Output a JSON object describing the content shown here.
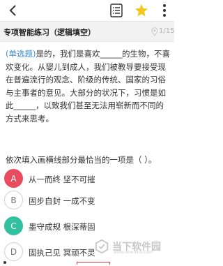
{
  "header": {
    "back_icon": "back-chevron-icon",
    "list_icon": "question-list-icon",
    "star_icon": "star-icon",
    "more_icon": "more-vertical-icon"
  },
  "subheader": {
    "title": "专项智能练习（逻辑填空）",
    "progress": "1/15"
  },
  "question": {
    "type_label": "(单选题)",
    "segment1": "是的，我们是喜欢",
    "blank1": "______",
    "segment2": "的生物，不喜欢变化。从婴儿到成人，我们被教导要接受现在普遍流行的观念、阶级的传统、国家的习俗与主事者的意见。大部分的状况下，习惯是如此",
    "blank2": "______",
    "segment3": "，以致我们甚至无法用崭新而不同的方式来思考。"
  },
  "prompt": "依次填入画横线部分最恰当的一项是（   ）。",
  "options": [
    {
      "letter": "A",
      "text": "从一而终  坚不可摧",
      "state": "wrong"
    },
    {
      "letter": "B",
      "text": "固步自封  一成不变",
      "state": "normal"
    },
    {
      "letter": "C",
      "text": "墨守成规  根深蒂固",
      "state": "right"
    },
    {
      "letter": "D",
      "text": "固执己见  冥顽不灵",
      "state": "normal"
    }
  ],
  "watermark": {
    "text": "当下软件园",
    "url": "www.downxia.com"
  },
  "colors": {
    "accent_blue": "#3f8fd2",
    "wrong_red": "#e94c5f",
    "correct_green": "#33c0a0",
    "star_yellow": "#f5c518"
  }
}
